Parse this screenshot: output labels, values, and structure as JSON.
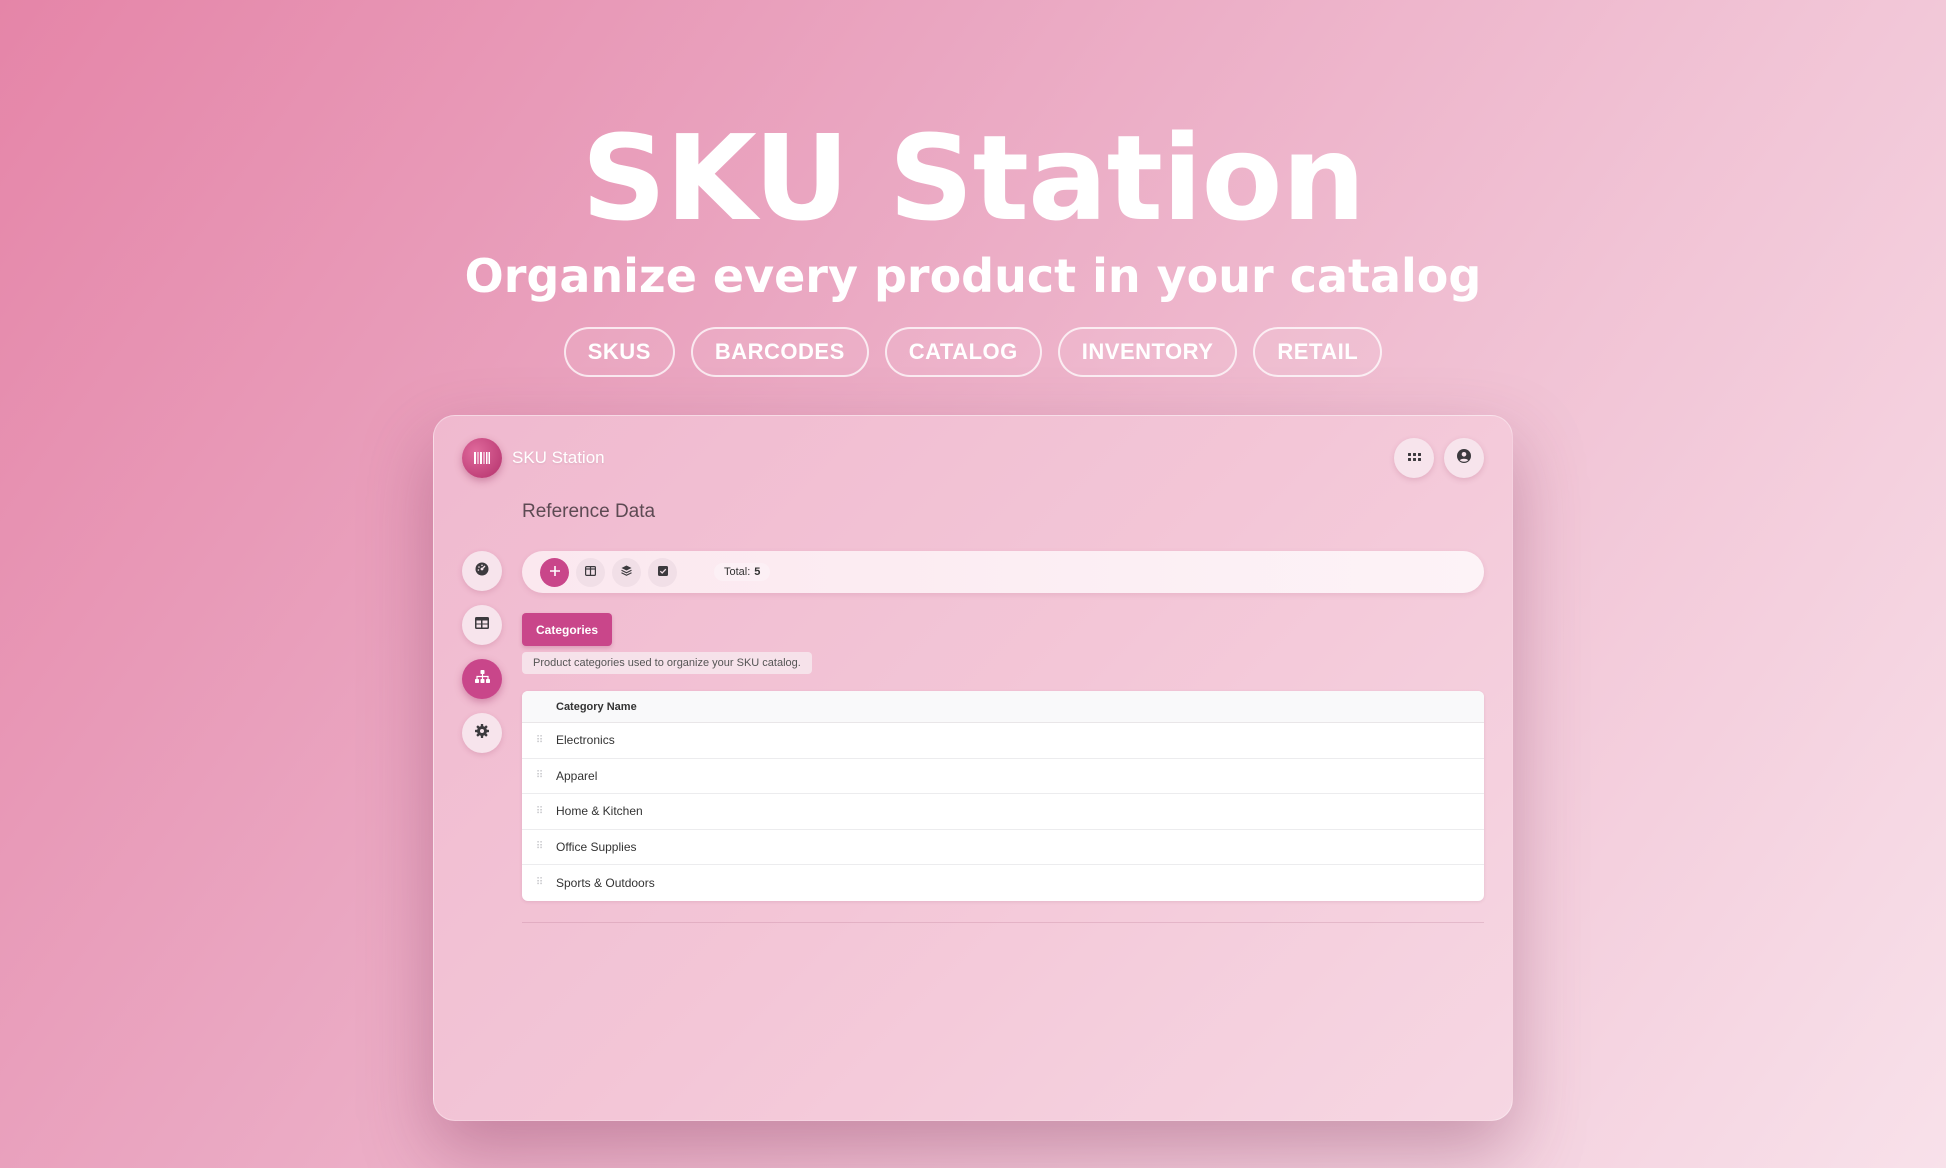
{
  "hero": {
    "title": "SKU Station",
    "subtitle": "Organize every product in your catalog",
    "tags": [
      "SKUS",
      "BARCODES",
      "CATALOG",
      "INVENTORY",
      "RETAIL"
    ]
  },
  "app": {
    "brand_name": "SKU Station",
    "page_title": "Reference Data",
    "toolbar": {
      "total_label": "Total:",
      "total_value": "5"
    },
    "active_tab": "Categories",
    "description": "Product categories used to organize your SKU catalog.",
    "table": {
      "header": "Category Name",
      "rows": [
        "Electronics",
        "Apparel",
        "Home & Kitchen",
        "Office Supplies",
        "Sports & Outdoors"
      ]
    }
  },
  "icons": {
    "brand": "barcode-icon",
    "top_actions": [
      "apps-grid-icon",
      "user-circle-icon"
    ],
    "side_nav": [
      "dashboard-icon",
      "table-icon",
      "hierarchy-icon",
      "gear-icon"
    ],
    "toolbar": [
      "plus-icon",
      "columns-icon",
      "layers-icon",
      "checkbox-icon"
    ]
  },
  "colors": {
    "accent": "#c9468a",
    "text_dark": "#333333"
  }
}
